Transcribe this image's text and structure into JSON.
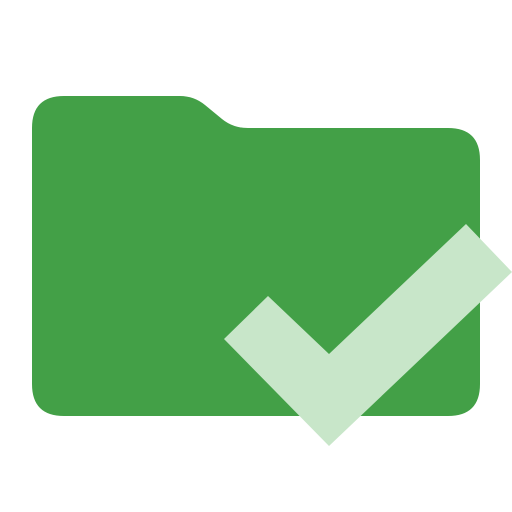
{
  "icon": {
    "name": "folder-check-icon",
    "colors": {
      "folder": "#43A047",
      "check": "#C8E6C9",
      "background": "#FFFFFF"
    }
  }
}
